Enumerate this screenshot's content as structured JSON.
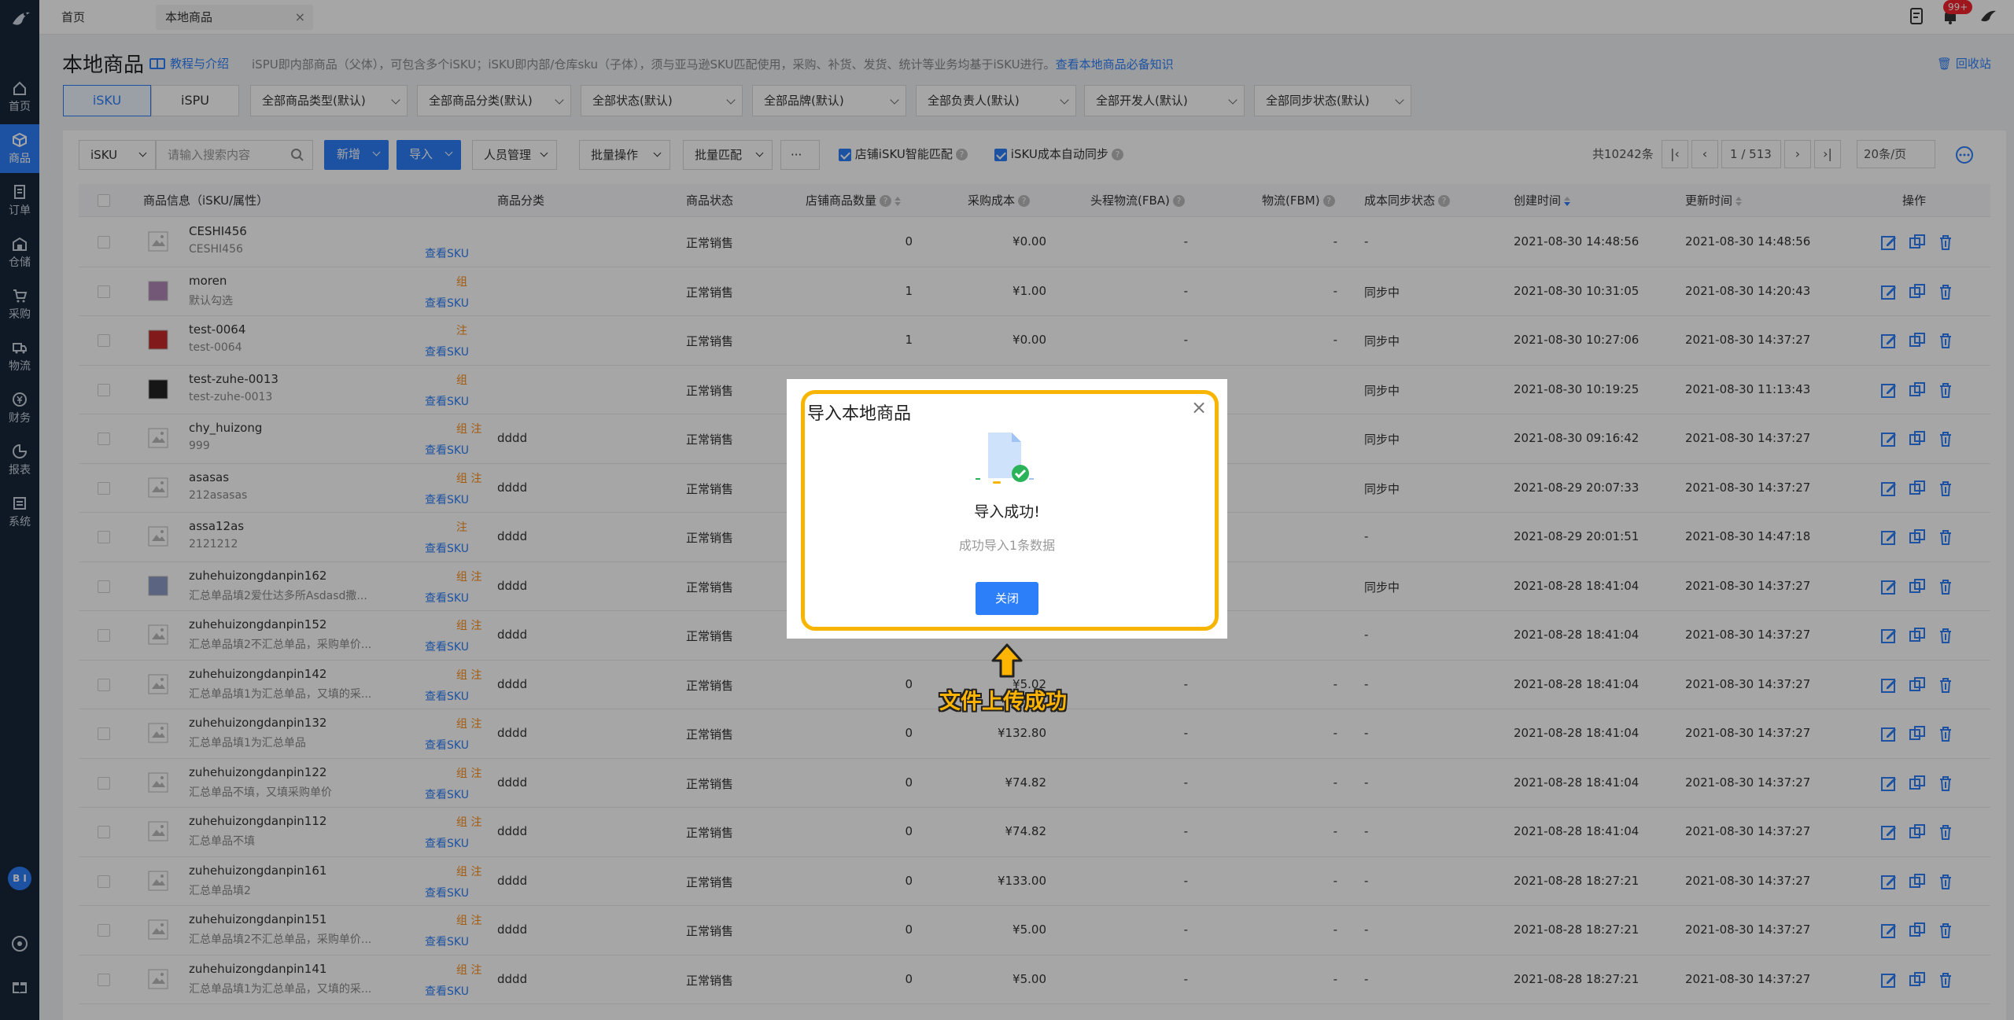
{
  "sidebar": {
    "items": [
      {
        "label": "首页",
        "icon": "home-icon"
      },
      {
        "label": "商品",
        "icon": "cube-icon",
        "active": true
      },
      {
        "label": "订单",
        "icon": "order-icon"
      },
      {
        "label": "仓储",
        "icon": "warehouse-icon"
      },
      {
        "label": "采购",
        "icon": "cart-icon"
      },
      {
        "label": "物流",
        "icon": "truck-icon"
      },
      {
        "label": "财务",
        "icon": "finance-icon"
      },
      {
        "label": "报表",
        "icon": "chart-icon"
      },
      {
        "label": "系统",
        "icon": "system-icon"
      }
    ],
    "avatar": "B I"
  },
  "tabs": [
    {
      "label": "首页"
    },
    {
      "label": "本地商品",
      "close": "×"
    }
  ],
  "notification_badge": "99+",
  "header": {
    "title": "本地商品",
    "tutorial": "教程与介绍",
    "description": "iSPU即内部商品（父体），可包含多个iSKU；iSKU即内部/仓库sku（子体），须与亚马逊SKU匹配使用，采购、补货、发货、统计等业务均基于iSKU进行。",
    "knowledge_link": "查看本地商品必备知识",
    "recycle": "回收站"
  },
  "filters": {
    "segments": [
      "iSKU",
      "iSPU"
    ],
    "selects": [
      "全部商品类型(默认)",
      "全部商品分类(默认)",
      "全部状态(默认)",
      "全部品牌(默认)",
      "全部负责人(默认)",
      "全部开发人(默认)",
      "全部同步状态(默认)"
    ]
  },
  "toolbar": {
    "search_type": "iSKU",
    "search_placeholder": "请输入搜索内容",
    "add": "新增",
    "import": "导入",
    "staff": "人员管理",
    "batch_ops": "批量操作",
    "batch_match": "批量匹配",
    "more": "···",
    "check1": "店铺iSKU智能匹配",
    "check2": "iSKU成本自动同步",
    "total": "共10242条",
    "page": "1",
    "pages": "/ 513",
    "page_size": "20条/页"
  },
  "table": {
    "headers": [
      "商品信息（iSKU/属性）",
      "商品分类",
      "商品状态",
      "店铺商品数量",
      "采购成本",
      "头程物流(FBA)",
      "物流(FBM)",
      "成本同步状态",
      "创建时间",
      "更新时间",
      "操作"
    ],
    "view_sku": "查看SKU",
    "rows": [
      {
        "sku": "CESHI456",
        "attr": "CESHI456",
        "tags": "",
        "cat": "",
        "status": "正常销售",
        "qty": "0",
        "cost": "¥0.00",
        "fba": "-",
        "fbm": "-",
        "sync": "-",
        "created": "2021-08-30 14:48:56",
        "updated": "2021-08-30 14:48:56"
      },
      {
        "sku": "moren",
        "attr": "默认勾选",
        "tags": "组",
        "cat": "",
        "status": "正常销售",
        "qty": "1",
        "cost": "¥1.00",
        "fba": "-",
        "fbm": "-",
        "sync": "同步中",
        "created": "2021-08-30 10:31:05",
        "updated": "2021-08-30 14:20:43"
      },
      {
        "sku": "test-0064",
        "attr": "test-0064",
        "tags": "注",
        "cat": "",
        "status": "正常销售",
        "qty": "1",
        "cost": "¥0.00",
        "fba": "-",
        "fbm": "-",
        "sync": "同步中",
        "created": "2021-08-30 10:27:06",
        "updated": "2021-08-30 14:37:27"
      },
      {
        "sku": "test-zuhe-0013",
        "attr": "test-zuhe-0013",
        "tags": "组",
        "cat": "",
        "status": "正常销售",
        "qty": "",
        "cost": "",
        "fba": "",
        "fbm": "",
        "sync": "同步中",
        "created": "2021-08-30 10:19:25",
        "updated": "2021-08-30 11:13:43"
      },
      {
        "sku": "chy_huizong",
        "attr": "999",
        "tags": "组 注",
        "cat": "dddd",
        "status": "正常销售",
        "qty": "",
        "cost": "",
        "fba": "",
        "fbm": "",
        "sync": "同步中",
        "created": "2021-08-30 09:16:42",
        "updated": "2021-08-30 14:37:27"
      },
      {
        "sku": "asasas",
        "attr": "212asasas",
        "tags": "组 注",
        "cat": "dddd",
        "status": "正常销售",
        "qty": "",
        "cost": "",
        "fba": "",
        "fbm": "",
        "sync": "同步中",
        "created": "2021-08-29 20:07:33",
        "updated": "2021-08-30 14:37:27"
      },
      {
        "sku": "assa12as",
        "attr": "2121212",
        "tags": "注",
        "cat": "dddd",
        "status": "正常销售",
        "qty": "",
        "cost": "",
        "fba": "",
        "fbm": "",
        "sync": "-",
        "created": "2021-08-29 20:01:51",
        "updated": "2021-08-30 14:47:18"
      },
      {
        "sku": "zuhehuizongdanpin162",
        "attr": "汇总单品填2爱仕达多所Asdasd撒...",
        "tags": "组 注",
        "cat": "dddd",
        "status": "正常销售",
        "qty": "",
        "cost": "",
        "fba": "",
        "fbm": "",
        "sync": "同步中",
        "created": "2021-08-28 18:41:04",
        "updated": "2021-08-30 14:37:27"
      },
      {
        "sku": "zuhehuizongdanpin152",
        "attr": "汇总单品填2不汇总单品，采购单价...",
        "tags": "组 注",
        "cat": "dddd",
        "status": "正常销售",
        "qty": "",
        "cost": "",
        "fba": "",
        "fbm": "",
        "sync": "-",
        "created": "2021-08-28 18:41:04",
        "updated": "2021-08-30 14:37:27"
      },
      {
        "sku": "zuhehuizongdanpin142",
        "attr": "汇总单品填1为汇总单品，又填的采...",
        "tags": "组 注",
        "cat": "dddd",
        "status": "正常销售",
        "qty": "0",
        "cost": "¥5.02",
        "fba": "-",
        "fbm": "-",
        "sync": "-",
        "created": "2021-08-28 18:41:04",
        "updated": "2021-08-30 14:37:27"
      },
      {
        "sku": "zuhehuizongdanpin132",
        "attr": "汇总单品填1为汇总单品",
        "tags": "组 注",
        "cat": "dddd",
        "status": "正常销售",
        "qty": "0",
        "cost": "¥132.80",
        "fba": "-",
        "fbm": "-",
        "sync": "-",
        "created": "2021-08-28 18:41:04",
        "updated": "2021-08-30 14:37:27"
      },
      {
        "sku": "zuhehuizongdanpin122",
        "attr": "汇总单品不填，又填采购单价",
        "tags": "组 注",
        "cat": "dddd",
        "status": "正常销售",
        "qty": "0",
        "cost": "¥74.82",
        "fba": "-",
        "fbm": "-",
        "sync": "-",
        "created": "2021-08-28 18:41:04",
        "updated": "2021-08-30 14:37:27"
      },
      {
        "sku": "zuhehuizongdanpin112",
        "attr": "汇总单品不填",
        "tags": "组 注",
        "cat": "dddd",
        "status": "正常销售",
        "qty": "0",
        "cost": "¥74.82",
        "fba": "-",
        "fbm": "-",
        "sync": "-",
        "created": "2021-08-28 18:41:04",
        "updated": "2021-08-30 14:37:27"
      },
      {
        "sku": "zuhehuizongdanpin161",
        "attr": "汇总单品填2",
        "tags": "组 注",
        "cat": "dddd",
        "status": "正常销售",
        "qty": "0",
        "cost": "¥133.00",
        "fba": "-",
        "fbm": "-",
        "sync": "-",
        "created": "2021-08-28 18:27:21",
        "updated": "2021-08-30 14:37:27"
      },
      {
        "sku": "zuhehuizongdanpin151",
        "attr": "汇总单品填2不汇总单品，采购单价...",
        "tags": "组 注",
        "cat": "dddd",
        "status": "正常销售",
        "qty": "0",
        "cost": "¥5.00",
        "fba": "-",
        "fbm": "-",
        "sync": "-",
        "created": "2021-08-28 18:27:21",
        "updated": "2021-08-30 14:37:27"
      },
      {
        "sku": "zuhehuizongdanpin141",
        "attr": "汇总单品填1为汇总单品，又填的采...",
        "tags": "组 注",
        "cat": "dddd",
        "status": "正常销售",
        "qty": "0",
        "cost": "¥5.00",
        "fba": "-",
        "fbm": "-",
        "sync": "-",
        "created": "2021-08-28 18:27:21",
        "updated": "2021-08-30 14:37:27"
      }
    ]
  },
  "modal": {
    "title": "导入本地商品",
    "close": "×",
    "heading": "导入成功!",
    "subtext": "成功导入1条数据",
    "button": "关闭"
  },
  "annotation": "文件上传成功",
  "colors": {
    "accent": "#2d7ff9",
    "highlight": "#f7b500",
    "sidebar": "#17273b",
    "tag": "#fa8c16"
  }
}
